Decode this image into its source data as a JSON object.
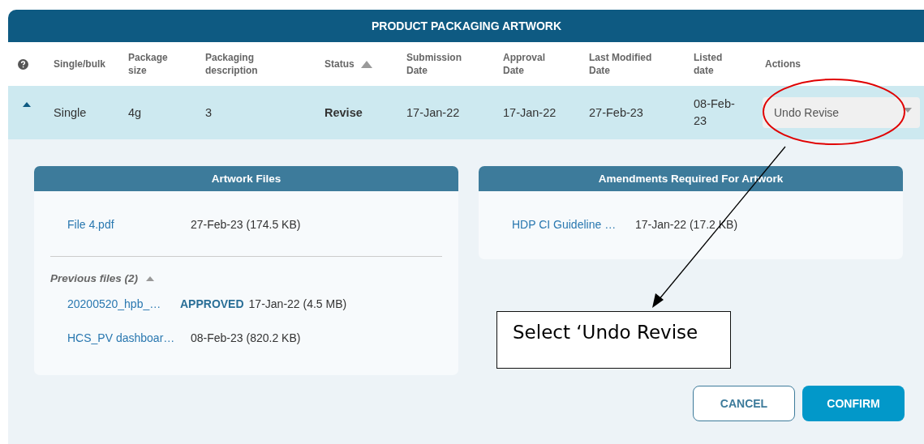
{
  "window": {
    "title": "PRODUCT PACKAGING ARTWORK"
  },
  "table": {
    "columns": [
      {
        "label": "Single/bulk"
      },
      {
        "label": "Package size"
      },
      {
        "label": "Packaging description"
      },
      {
        "label": "Status",
        "sorted": true,
        "kind": "status"
      },
      {
        "label": "Submission Date"
      },
      {
        "label": "Approval Date"
      },
      {
        "label": "Last Modified Date"
      },
      {
        "label": "Listed date"
      },
      {
        "label": "Actions"
      }
    ],
    "rows": [
      {
        "expanded": true,
        "cells": [
          "Single",
          "4g",
          "3",
          "Revise",
          "17-Jan-22",
          "17-Jan-22",
          "27-Feb-23",
          "08-Feb-23"
        ],
        "action": "Undo Revise"
      }
    ]
  },
  "artwork_files": {
    "title": "Artwork Files",
    "current": [
      {
        "name": "File 4.pdf",
        "info": "27-Feb-23 (174.5 KB)"
      }
    ],
    "previous": {
      "label": "Previous files (2)",
      "expanded": true,
      "files": [
        {
          "name": "20200520_hpb_…",
          "badge": "APPROVED",
          "info": "17-Jan-22 (4.5 MB)"
        },
        {
          "name": "HCS_PV dashboar…",
          "info": "08-Feb-23 (820.2 KB)"
        }
      ]
    }
  },
  "amendments": {
    "title": "Amendments Required For Artwork",
    "files": [
      {
        "name": "HDP CI Guideline …",
        "info": "17-Jan-22 (17.2 KB)"
      }
    ]
  },
  "buttons": [
    {
      "label": "CANCEL",
      "kind": "secondary"
    },
    {
      "label": "CONFIRM",
      "kind": "primary"
    }
  ],
  "annotation": {
    "text": "Select ‘Undo Revise"
  }
}
